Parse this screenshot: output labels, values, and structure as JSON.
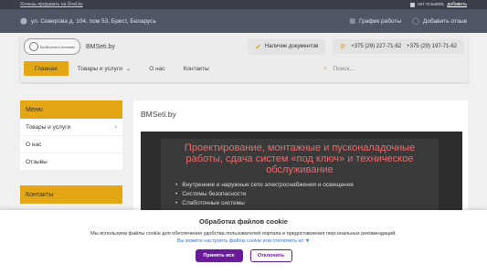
{
  "topstrip": {
    "sell_link": "Хочешь продавать на Deal.by",
    "reviews_text": "нет отзывов,",
    "add_link": "добавить"
  },
  "infobar": {
    "address": "ул. Северова д. 104, пом 53, Брест, Беларусь",
    "schedule": "График работы",
    "add_review": "Добавить отзыв"
  },
  "header": {
    "logo_text": "БелБизнесСистемы",
    "site_name": "BMSeti.by",
    "docs_label": "Наличие документов",
    "phone1": "+375 (29) 227-71-62",
    "phone2": "+375 (29) 197-71-62"
  },
  "nav": {
    "items": [
      "Главная",
      "Товары и услуги",
      "О нас",
      "Контакты"
    ],
    "search_placeholder": "Поиск..."
  },
  "sidebar": {
    "menu_title": "Меню",
    "items": [
      "Товары и услуги",
      "О нас",
      "Отзывы"
    ],
    "contacts_title": "Контакты"
  },
  "main": {
    "title": "BMSeti.by",
    "banner_heading": "Проектирование, монтажные и пусконаладочные работы, сдача систем «под ключ» и техническое обслуживание",
    "banner_items": [
      "Внутренние и наружные сети электроснабжения и освещения",
      "Системы безопасности",
      "Слаботочные системы"
    ]
  },
  "cookie": {
    "title": "Обработка файлов cookie",
    "description": "Мы используем файлы cookie для обеспечения удобства пользователей портала и предоставления персональных рекомендаций.",
    "settings_link": "Вы можете настроить файлы cookie или отключить их ▼",
    "accept": "Принять все",
    "decline": "Отклонить"
  }
}
